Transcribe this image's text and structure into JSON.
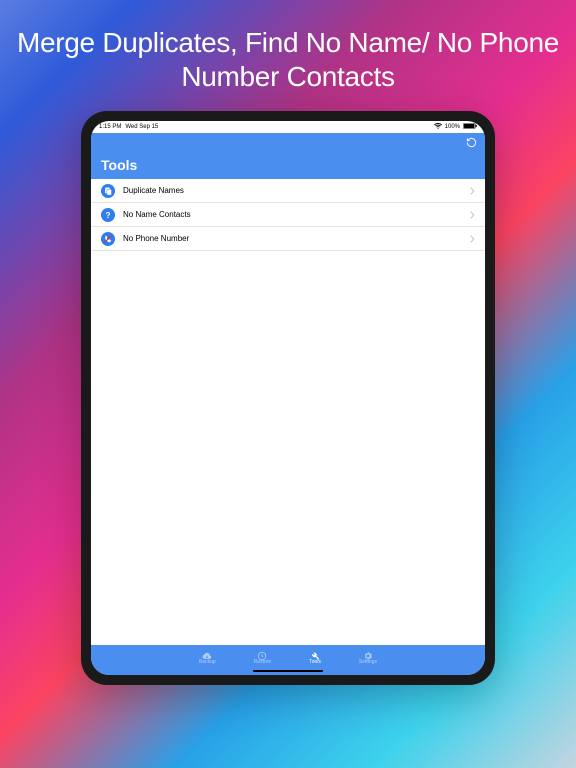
{
  "headline": "Merge Duplicates, Find No Name/ No Phone Number Contacts",
  "status": {
    "time": "1:15 PM",
    "date": "Wed Sep 15",
    "battery": "100%"
  },
  "navTitle": "Tools",
  "rows": [
    {
      "label": "Duplicate Names"
    },
    {
      "label": "No Name Contacts"
    },
    {
      "label": "No Phone Number"
    }
  ],
  "tabs": [
    {
      "label": "Backup"
    },
    {
      "label": "Restore"
    },
    {
      "label": "Tools"
    },
    {
      "label": "Settings"
    }
  ]
}
